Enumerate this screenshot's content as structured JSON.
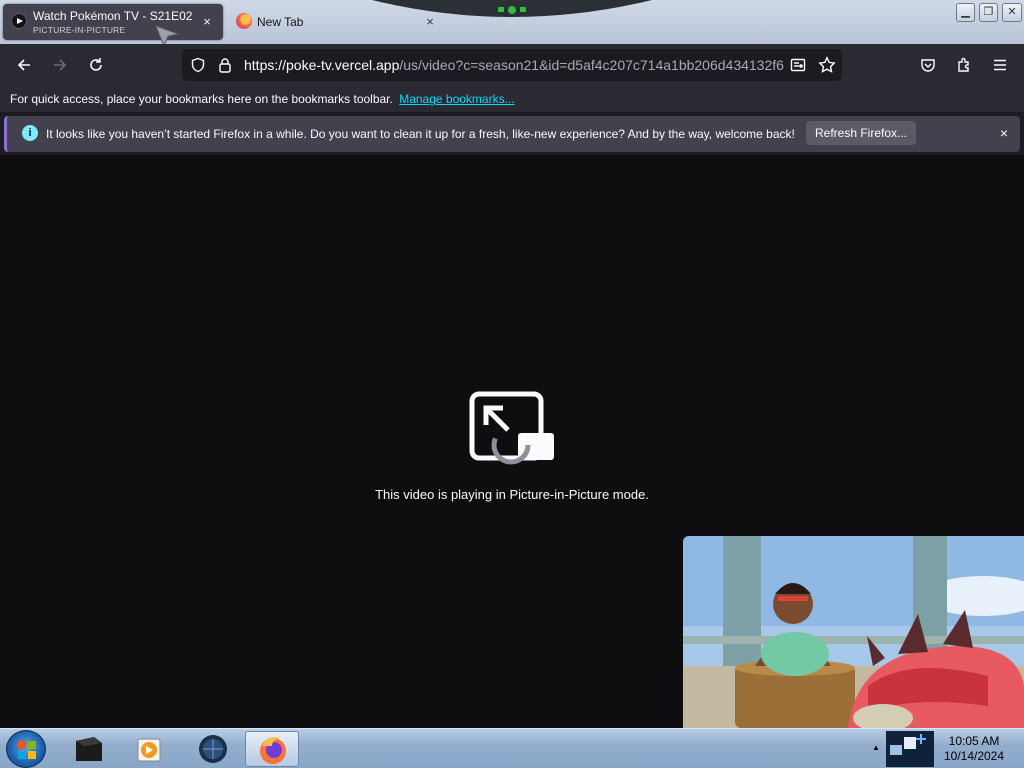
{
  "tabs": [
    {
      "title": "Watch Pokémon TV - S21E02 -",
      "subtitle": "PICTURE-IN-PICTURE",
      "close": "×",
      "active": true
    },
    {
      "title": "New Tab",
      "close": "×",
      "active": false
    }
  ],
  "window_controls": {
    "minimize": "▁",
    "restore": "❐",
    "close": "✕"
  },
  "navbar": {
    "url_host": "https://poke-tv.vercel.app",
    "url_path": "/us/video?c=season21&id=d5af4c207c714a1bb206d434132f6",
    "icons": [
      "back-icon",
      "forward-icon",
      "reload-icon",
      "shield-icon",
      "lock-icon",
      "reader-view-icon",
      "bookmark-star-icon",
      "pocket-icon",
      "extensions-icon",
      "menu-icon"
    ]
  },
  "bookmarks_bar": {
    "text": "For quick access, place your bookmarks here on the bookmarks toolbar.",
    "link": "Manage bookmarks..."
  },
  "notification": {
    "icon": "i",
    "message": "It looks like you haven’t started Firefox in a while. Do you want to clean it up for a fresh, like-new experience? And by the way, welcome back!",
    "button": "Refresh Firefox...",
    "close": "×"
  },
  "content": {
    "pip_message": "This video is playing in Picture-in-Picture mode."
  },
  "taskbar": {
    "time": "10:05 AM",
    "date": "10/14/2024",
    "tray_arrow": "▲",
    "apps": [
      "file-explorer-icon",
      "media-player-icon",
      "network-app-icon",
      "firefox-icon"
    ]
  },
  "colors": {
    "accent": "#00ddff",
    "toolbar": "#2b2a33",
    "content_bg": "#0e0d10",
    "active_tab": "#42414d"
  }
}
